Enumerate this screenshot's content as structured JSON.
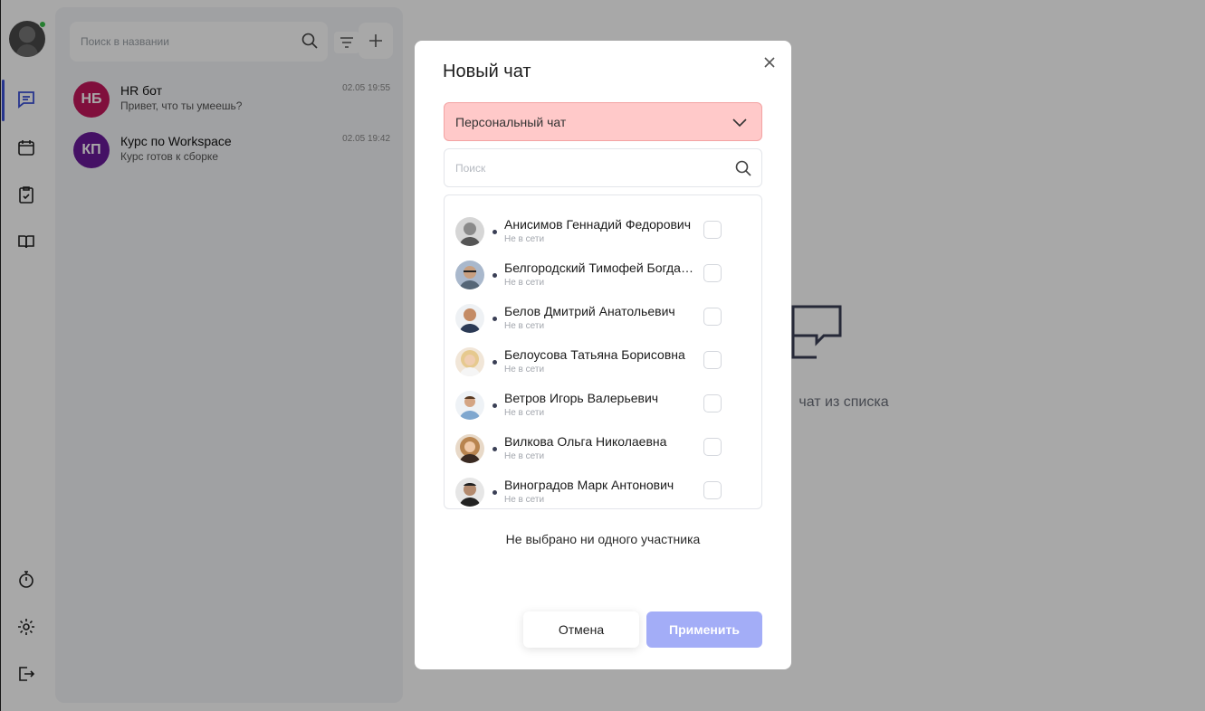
{
  "sidebar": {
    "items": [
      {
        "name": "chat-icon",
        "active": true
      },
      {
        "name": "calendar-icon",
        "active": false
      },
      {
        "name": "task-icon",
        "active": false
      },
      {
        "name": "book-icon",
        "active": false
      }
    ],
    "bottom_items": [
      "stopwatch-icon",
      "gear-icon",
      "logout-icon"
    ],
    "online_color": "#3bbf4a",
    "accent": "#3a4fd6"
  },
  "chat_list": {
    "search_placeholder": "Поиск в названии",
    "chats": [
      {
        "initials": "НБ",
        "color": "#c2185b",
        "name": "HR бот",
        "preview": "Привет, что ты умеешь?",
        "time": "02.05 19:55"
      },
      {
        "initials": "КП",
        "color": "#6a1b9a",
        "name": "Курс по Workspace",
        "preview": "Курс готов к сборке",
        "time": "02.05 19:42"
      }
    ]
  },
  "main": {
    "empty_text": "чат из списка"
  },
  "modal": {
    "title": "Новый чат",
    "chat_type": "Персональный чат",
    "search_placeholder": "Поиск",
    "people": [
      {
        "name": "Анисимов Геннадий Федорович",
        "status": "Не в сети"
      },
      {
        "name": "Белгородский Тимофей Богданович",
        "status": "Не в сети"
      },
      {
        "name": "Белов Дмитрий Анатольевич",
        "status": "Не в сети"
      },
      {
        "name": "Белоусова Татьяна Борисовна",
        "status": "Не в сети"
      },
      {
        "name": "Ветров Игорь Валерьевич",
        "status": "Не в сети"
      },
      {
        "name": "Вилкова Ольга Николаевна",
        "status": "Не в сети"
      },
      {
        "name": "Виноградов Марк Антонович",
        "status": "Не в сети"
      }
    ],
    "none_selected": "Не выбрано ни одного участника",
    "cancel_label": "Отмена",
    "apply_label": "Применить",
    "select_color": "#ffc9c9",
    "apply_color": "#a3adf7"
  }
}
